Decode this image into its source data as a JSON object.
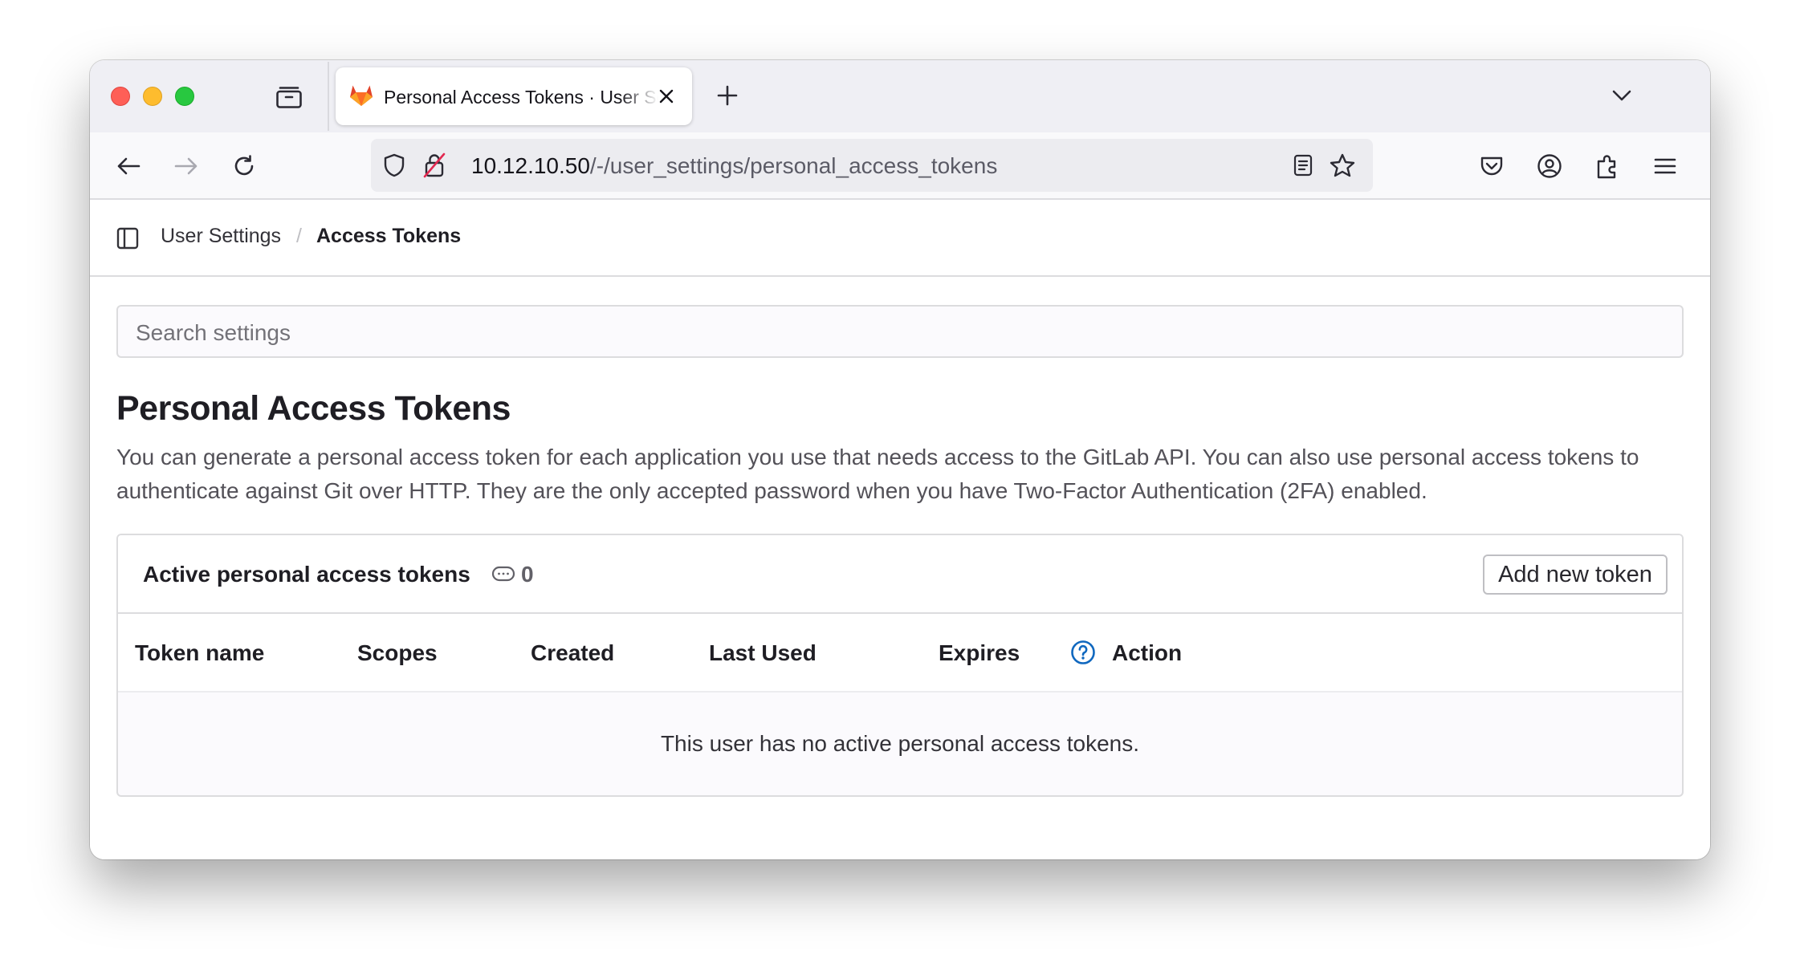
{
  "browser": {
    "tab": {
      "title": "Personal Access Tokens · User Settings"
    },
    "url": {
      "host": "10.12.10.50",
      "path": "/-/user_settings/personal_access_tokens"
    }
  },
  "breadcrumb": {
    "parent": "User Settings",
    "separator": "/",
    "current": "Access Tokens"
  },
  "search": {
    "placeholder": "Search settings"
  },
  "main": {
    "title": "Personal Access Tokens",
    "description": "You can generate a personal access token for each application you use that needs access to the GitLab API. You can also use personal access tokens to authenticate against Git over HTTP. They are the only accepted password when you have Two-Factor Authentication (2FA) enabled."
  },
  "tokens_card": {
    "title": "Active personal access tokens",
    "count": "0",
    "add_button": "Add new token",
    "columns": [
      "Token name",
      "Scopes",
      "Created",
      "Last Used",
      "Expires",
      "Action"
    ],
    "empty_message": "This user has no active personal access tokens."
  },
  "icons": {
    "favicon": "gitlab-tanuki-icon",
    "count_icon": "token-icon",
    "help": "question-circle-icon"
  },
  "colors": {
    "gitlab_orange": "#e24329",
    "help_blue": "#1068bf",
    "close_red": "#fe5f57",
    "minimize_yellow": "#febc2e",
    "zoom_green": "#28c840"
  }
}
